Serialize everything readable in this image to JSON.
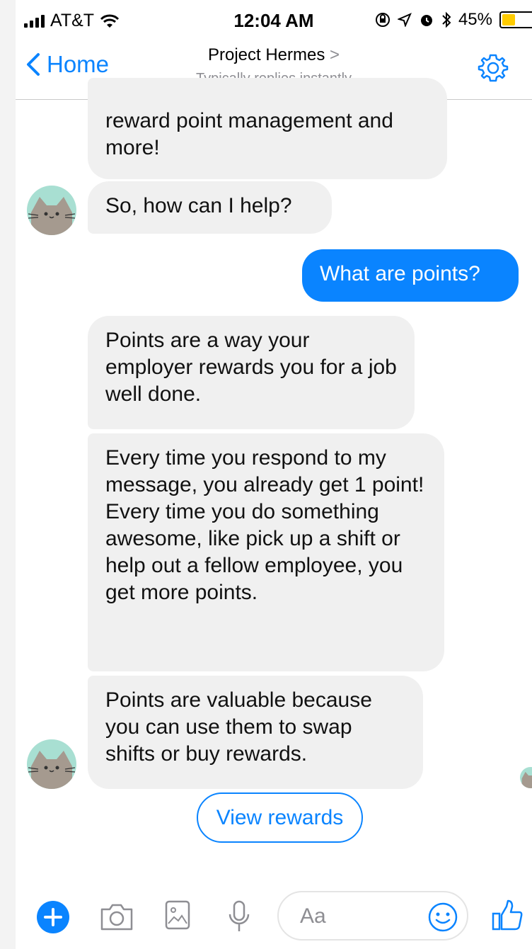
{
  "status_bar": {
    "carrier": "AT&T",
    "time": "12:04 AM",
    "battery": "45%",
    "battery_level": 0.45
  },
  "nav": {
    "back_label": "Home",
    "title": "Project Hermes",
    "title_chevron": ">",
    "subtitle": "Typically replies instantly",
    "settings_icon": "gear-icon"
  },
  "messages": [
    {
      "from": "bot",
      "text": "reward point management and more!"
    },
    {
      "from": "bot",
      "text": "So, how can I help?"
    },
    {
      "from": "user",
      "text": "What are points?"
    },
    {
      "from": "bot",
      "text": "Points are a way your employer rewards you for a job well done."
    },
    {
      "from": "bot",
      "text": "Every time you respond to my message, you already get 1 point! Every time you do something awesome, like pick up a shift or help out a fellow employee, you get more points."
    },
    {
      "from": "bot",
      "text": "Points are valuable because you can use them to swap shifts or buy rewards."
    }
  ],
  "quick_reply": {
    "label": "View rewards"
  },
  "composer": {
    "placeholder": "Aa",
    "icons": [
      "plus-icon",
      "camera-icon",
      "image-icon",
      "microphone-icon",
      "emoji-icon",
      "thumbs-up-icon"
    ]
  },
  "colors": {
    "accent": "#0a84ff",
    "bubble_gray": "#f0f0f0",
    "battery": "#ffcc00"
  }
}
